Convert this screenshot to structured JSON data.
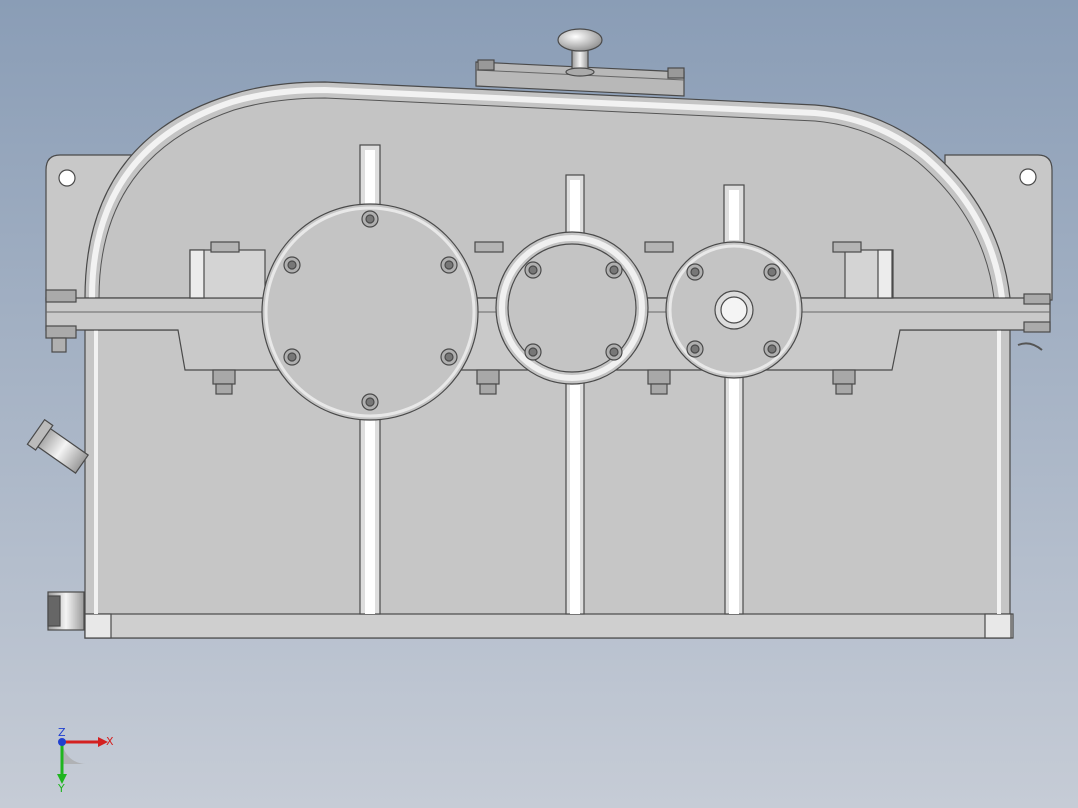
{
  "viewport": {
    "background_top": "#8a9db6",
    "background_bottom": "#c6ccd6"
  },
  "model": {
    "housing_fill": "#c4c4c4",
    "housing_stroke": "#4a4a4a",
    "rib_fill": "#dedede",
    "highlight": "#f2f2f2"
  },
  "triad": {
    "x_label": "X",
    "y_label": "Y",
    "z_label": "Z",
    "x_color": "#d42020",
    "y_color": "#1fb51f",
    "z_color": "#2040d0"
  }
}
